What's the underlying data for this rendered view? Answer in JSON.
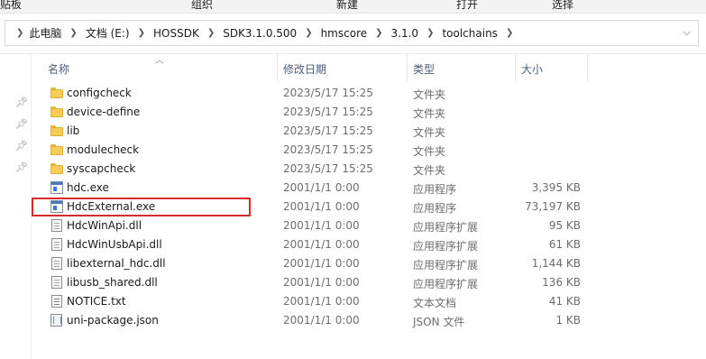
{
  "ribbon": {
    "groups": [
      "贴板",
      "组织",
      "新建",
      "打开",
      "选择"
    ]
  },
  "address_bar": {
    "crumbs": [
      "此电脑",
      "文档 (E:)",
      "HOSSDK",
      "SDK3.1.0.500",
      "hmscore",
      "3.1.0",
      "toolchains"
    ]
  },
  "columns": {
    "name": "名称",
    "date": "修改日期",
    "type": "类型",
    "size": "大小"
  },
  "files": [
    {
      "name": "configcheck",
      "date": "2023/5/17 15:25",
      "type": "文件夹",
      "size": "",
      "icon": "folder-icon"
    },
    {
      "name": "device-define",
      "date": "2023/5/17 15:25",
      "type": "文件夹",
      "size": "",
      "icon": "folder-icon"
    },
    {
      "name": "lib",
      "date": "2023/5/17 15:25",
      "type": "文件夹",
      "size": "",
      "icon": "folder-icon"
    },
    {
      "name": "modulecheck",
      "date": "2023/5/17 15:25",
      "type": "文件夹",
      "size": "",
      "icon": "folder-icon"
    },
    {
      "name": "syscapcheck",
      "date": "2023/5/17 15:25",
      "type": "文件夹",
      "size": "",
      "icon": "folder-icon"
    },
    {
      "name": "hdc.exe",
      "date": "2001/1/1 0:00",
      "type": "应用程序",
      "size": "3,395 KB",
      "icon": "exe-icon"
    },
    {
      "name": "HdcExternal.exe",
      "date": "2001/1/1 0:00",
      "type": "应用程序",
      "size": "73,197 KB",
      "icon": "exe-icon"
    },
    {
      "name": "HdcWinApi.dll",
      "date": "2001/1/1 0:00",
      "type": "应用程序扩展",
      "size": "95 KB",
      "icon": "dll-icon"
    },
    {
      "name": "HdcWinUsbApi.dll",
      "date": "2001/1/1 0:00",
      "type": "应用程序扩展",
      "size": "61 KB",
      "icon": "dll-icon"
    },
    {
      "name": "libexternal_hdc.dll",
      "date": "2001/1/1 0:00",
      "type": "应用程序扩展",
      "size": "1,144 KB",
      "icon": "dll-icon"
    },
    {
      "name": "libusb_shared.dll",
      "date": "2001/1/1 0:00",
      "type": "应用程序扩展",
      "size": "136 KB",
      "icon": "dll-icon"
    },
    {
      "name": "NOTICE.txt",
      "date": "2001/1/1 0:00",
      "type": "文本文档",
      "size": "41 KB",
      "icon": "txt-icon"
    },
    {
      "name": "uni-package.json",
      "date": "2001/1/1 0:00",
      "type": "JSON 文件",
      "size": "1 KB",
      "icon": "json-icon"
    }
  ],
  "highlighted_file": "HdcExternal.exe",
  "colors": {
    "highlight_border": "#d42b2b",
    "header_text": "#4c607a",
    "folder": "#f8cd56"
  }
}
